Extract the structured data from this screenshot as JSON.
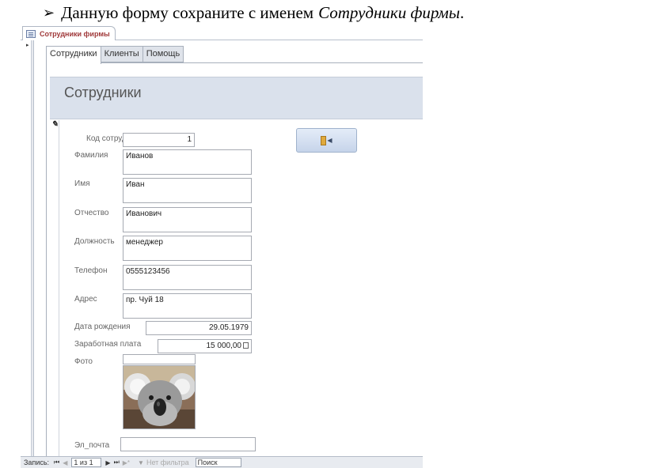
{
  "caption": {
    "bullet": "➢",
    "text": "Данную форму сохраните с именем",
    "name": "Сотрудники фирмы",
    "end": "."
  },
  "document_tab": {
    "label": "Сотрудники фирмы",
    "icon": "form-icon"
  },
  "tabs": [
    {
      "label": "Сотрудники",
      "active": true
    },
    {
      "label": "Клиенты",
      "active": false
    },
    {
      "label": "Помощь",
      "active": false
    }
  ],
  "form": {
    "title": "Сотрудники",
    "fields": {
      "id": {
        "label": "Код сотруд",
        "value": "1"
      },
      "last_name": {
        "label": "Фамилия",
        "value": "Иванов"
      },
      "first_name": {
        "label": "Имя",
        "value": "Иван"
      },
      "patronymic": {
        "label": "Отчество",
        "value": "Иванович"
      },
      "position": {
        "label": "Должность",
        "value": "менеджер"
      },
      "phone": {
        "label": "Телефон",
        "value": "0555123456"
      },
      "address": {
        "label": "Адрес",
        "value": "пр. Чуй 18"
      },
      "birth_date": {
        "label": "Дата рождения",
        "value": "29.05.1979"
      },
      "salary": {
        "label": "Заработная плата",
        "value": "15 000,00"
      },
      "photo": {
        "label": "Фото"
      },
      "email": {
        "label": "Эл_почта",
        "value": ""
      }
    },
    "nav_button": {
      "icon": "exit-door-icon"
    }
  },
  "status_bar": {
    "records_label": "Запись:",
    "position": "1 из 1",
    "filter": "Нет фильтра",
    "search": "Поиск"
  },
  "colors": {
    "header_bg": "#dae1ec",
    "tab_title": "#a0393a",
    "button_bg": "#c6d4ea"
  }
}
